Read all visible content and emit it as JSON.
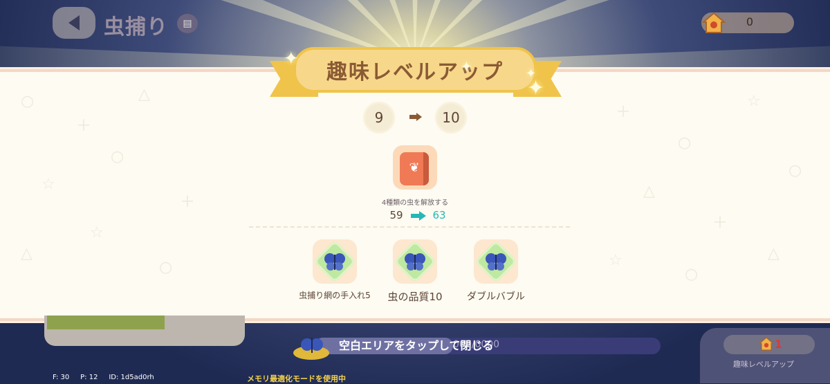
{
  "header": {
    "title": "虫捕り",
    "currency_value": "0"
  },
  "popup": {
    "title": "趣味レベルアップ",
    "level_from": "9",
    "level_to": "10",
    "reward": {
      "icon": "butterfly-book-icon",
      "description": "4種類の虫を解放する",
      "from_value": "59",
      "to_value": "63"
    },
    "skills": [
      {
        "icon": "blue-butterfly-icon",
        "label": "虫捕り網の手入れ5"
      },
      {
        "icon": "blue-butterfly-icon",
        "label": "虫の品質10"
      },
      {
        "icon": "blue-butterfly-icon",
        "label": "ダブルバブル"
      }
    ]
  },
  "bottom": {
    "close_hint": "空白エリアをタップして閉じる",
    "xp_text": "000/0000",
    "xp_fraction": 0.4,
    "levelup_count": "1",
    "levelup_label": "趣味レベルアップ"
  },
  "debug": {
    "stats": "F: 30     P: 12     ID: 1d5ad0rh",
    "memory_mode": "メモリ最適化モードを使用中"
  },
  "colors": {
    "accent_teal": "#26b7b7",
    "banner_gold": "#f0c44a",
    "text_brown": "#5d4434"
  }
}
